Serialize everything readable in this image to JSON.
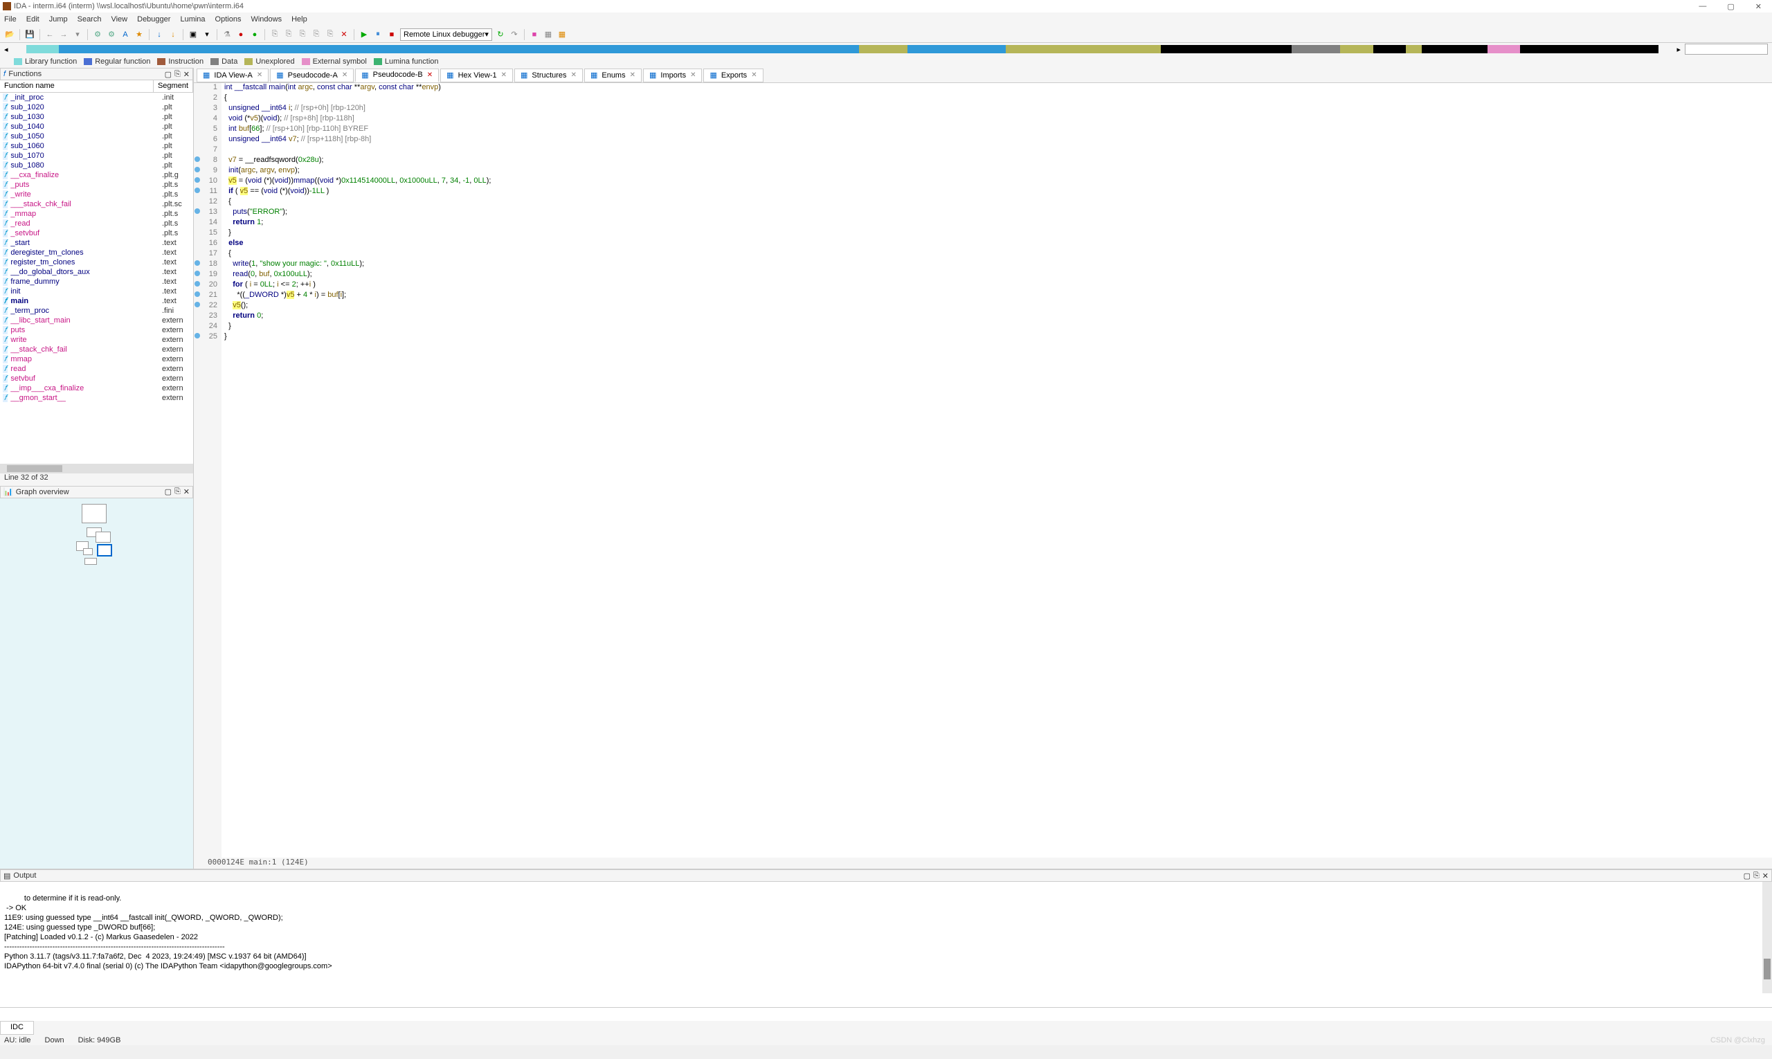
{
  "title": "IDA - interm.i64 (interm) \\\\wsl.localhost\\Ubuntu\\home\\pwn\\interm.i64",
  "menu": [
    "File",
    "Edit",
    "Jump",
    "Search",
    "View",
    "Debugger",
    "Lumina",
    "Options",
    "Windows",
    "Help"
  ],
  "debugger_text": "Remote Linux debugger",
  "legend": [
    {
      "label": "Library function",
      "color": "#7FDBDB"
    },
    {
      "label": "Regular function",
      "color": "#4A6FD4"
    },
    {
      "label": "Instruction",
      "color": "#A05B3C"
    },
    {
      "label": "Data",
      "color": "#808080"
    },
    {
      "label": "Unexplored",
      "color": "#B5B558"
    },
    {
      "label": "External symbol",
      "color": "#E68FC9"
    },
    {
      "label": "Lumina function",
      "color": "#3CB371"
    }
  ],
  "functions_panel": {
    "title": "Functions",
    "cols": [
      "Function name",
      "Segment"
    ],
    "status": "Line 32 of 32"
  },
  "functions": [
    {
      "name": "_init_proc",
      "seg": ".init",
      "ext": false
    },
    {
      "name": "sub_1020",
      "seg": ".plt",
      "ext": false
    },
    {
      "name": "sub_1030",
      "seg": ".plt",
      "ext": false
    },
    {
      "name": "sub_1040",
      "seg": ".plt",
      "ext": false
    },
    {
      "name": "sub_1050",
      "seg": ".plt",
      "ext": false
    },
    {
      "name": "sub_1060",
      "seg": ".plt",
      "ext": false
    },
    {
      "name": "sub_1070",
      "seg": ".plt",
      "ext": false
    },
    {
      "name": "sub_1080",
      "seg": ".plt",
      "ext": false
    },
    {
      "name": "__cxa_finalize",
      "seg": ".plt.g",
      "ext": true
    },
    {
      "name": "_puts",
      "seg": ".plt.s",
      "ext": true
    },
    {
      "name": "_write",
      "seg": ".plt.s",
      "ext": true
    },
    {
      "name": "___stack_chk_fail",
      "seg": ".plt.sc",
      "ext": true
    },
    {
      "name": "_mmap",
      "seg": ".plt.s",
      "ext": true
    },
    {
      "name": "_read",
      "seg": ".plt.s",
      "ext": true
    },
    {
      "name": "_setvbuf",
      "seg": ".plt.s",
      "ext": true
    },
    {
      "name": "_start",
      "seg": ".text",
      "ext": false
    },
    {
      "name": "deregister_tm_clones",
      "seg": ".text",
      "ext": false
    },
    {
      "name": "register_tm_clones",
      "seg": ".text",
      "ext": false
    },
    {
      "name": "__do_global_dtors_aux",
      "seg": ".text",
      "ext": false
    },
    {
      "name": "frame_dummy",
      "seg": ".text",
      "ext": false
    },
    {
      "name": "init",
      "seg": ".text",
      "ext": false
    },
    {
      "name": "main",
      "seg": ".text",
      "ext": false,
      "bold": true
    },
    {
      "name": "_term_proc",
      "seg": ".fini",
      "ext": false
    },
    {
      "name": "__libc_start_main",
      "seg": "extern",
      "ext": true
    },
    {
      "name": "puts",
      "seg": "extern",
      "ext": true
    },
    {
      "name": "write",
      "seg": "extern",
      "ext": true
    },
    {
      "name": "__stack_chk_fail",
      "seg": "extern",
      "ext": true
    },
    {
      "name": "mmap",
      "seg": "extern",
      "ext": true
    },
    {
      "name": "read",
      "seg": "extern",
      "ext": true
    },
    {
      "name": "setvbuf",
      "seg": "extern",
      "ext": true
    },
    {
      "name": "__imp___cxa_finalize",
      "seg": "extern",
      "ext": true
    },
    {
      "name": "__gmon_start__",
      "seg": "extern",
      "ext": true
    }
  ],
  "graph_panel": {
    "title": "Graph overview"
  },
  "tabs": [
    {
      "label": "IDA View-A",
      "icon": "view"
    },
    {
      "label": "Pseudocode-A",
      "icon": "code"
    },
    {
      "label": "Pseudocode-B",
      "icon": "code",
      "active": true,
      "red": true
    },
    {
      "label": "Hex View-1",
      "icon": "hex"
    },
    {
      "label": "Structures",
      "icon": "struct"
    },
    {
      "label": "Enums",
      "icon": "enum"
    },
    {
      "label": "Imports",
      "icon": "import"
    },
    {
      "label": "Exports",
      "icon": "export"
    }
  ],
  "code_status": "0000124E main:1 (124E)",
  "code_lines": [
    {
      "n": 1,
      "html": "<span class='ty'>int</span> <span class='ty'>__fastcall</span> <span class='fn'>main</span>(<span class='ty'>int</span> <span class='vr'>argc</span>, <span class='ty'>const char</span> **<span class='vr'>argv</span>, <span class='ty'>const char</span> **<span class='vr'>envp</span>)"
    },
    {
      "n": 2,
      "html": "{"
    },
    {
      "n": 3,
      "html": "  <span class='ty'>unsigned __int64</span> <span class='vr'>i</span>; <span class='cm'>// [rsp+0h] [rbp-120h]</span>"
    },
    {
      "n": 4,
      "html": "  <span class='ty'>void</span> (*<span class='vr'>v5</span>)(<span class='ty'>void</span>); <span class='cm'>// [rsp+8h] [rbp-118h]</span>"
    },
    {
      "n": 5,
      "html": "  <span class='ty'>int</span> <span class='vr'>buf</span>[<span class='num'>66</span>]; <span class='cm'>// [rsp+10h] [rbp-110h] BYREF</span>"
    },
    {
      "n": 6,
      "html": "  <span class='ty'>unsigned __int64</span> <span class='vr'>v7</span>; <span class='cm'>// [rsp+118h] [rbp-8h]</span>"
    },
    {
      "n": 7,
      "html": ""
    },
    {
      "n": 8,
      "bp": true,
      "html": "  <span class='vr'>v7</span> = __readfsqword(<span class='num'>0x28u</span>);"
    },
    {
      "n": 9,
      "bp": true,
      "html": "  <span class='fn'>init</span>(<span class='vr'>argc</span>, <span class='vr'>argv</span>, <span class='vr'>envp</span>);"
    },
    {
      "n": 10,
      "bp": true,
      "html": "  <span class='vr hl'>v5</span> = (<span class='ty'>void</span> (*)(<span class='ty'>void</span>))<span class='fn'>mmap</span>((<span class='ty'>void</span> *)<span class='num'>0x114514000LL</span>, <span class='num'>0x1000uLL</span>, <span class='num'>7</span>, <span class='num'>34</span>, <span class='num'>-1</span>, <span class='num'>0LL</span>);"
    },
    {
      "n": 11,
      "bp": true,
      "html": "  <span class='kw'>if</span> ( <span class='vr hl'>v5</span> == (<span class='ty'>void</span> (*)(<span class='ty'>void</span>))<span class='num'>-1LL</span> )"
    },
    {
      "n": 12,
      "html": "  {"
    },
    {
      "n": 13,
      "bp": true,
      "html": "    <span class='fn'>puts</span>(<span class='str'>\"ERROR\"</span>);"
    },
    {
      "n": 14,
      "html": "    <span class='kw'>return</span> <span class='num'>1</span>;"
    },
    {
      "n": 15,
      "html": "  }"
    },
    {
      "n": 16,
      "html": "  <span class='kw'>else</span>"
    },
    {
      "n": 17,
      "html": "  {"
    },
    {
      "n": 18,
      "bp": true,
      "html": "    <span class='fn'>write</span>(<span class='num'>1</span>, <span class='str'>\"show your magic: \"</span>, <span class='num'>0x11uLL</span>);"
    },
    {
      "n": 19,
      "bp": true,
      "html": "    <span class='fn'>read</span>(<span class='num'>0</span>, <span class='vr'>buf</span>, <span class='num'>0x100uLL</span>);"
    },
    {
      "n": 20,
      "bp": true,
      "html": "    <span class='kw'>for</span> ( <span class='vr'>i</span> = <span class='num'>0LL</span>; <span class='vr'>i</span> &lt;= <span class='num'>2</span>; ++<span class='vr'>i</span> )"
    },
    {
      "n": 21,
      "bp": true,
      "html": "      *((<span class='ty'>_DWORD</span> *)<span class='vr hl'>v5</span> + <span class='num'>4</span> * <span class='vr'>i</span>) = <span class='vr'>buf</span>[<span class='vr'>i</span>];"
    },
    {
      "n": 22,
      "bp": true,
      "html": "    <span class='vr hl'>v5</span>();"
    },
    {
      "n": 23,
      "html": "    <span class='kw'>return</span> <span class='num'>0</span>;"
    },
    {
      "n": 24,
      "html": "  }"
    },
    {
      "n": 25,
      "bp": true,
      "html": "}"
    }
  ],
  "output_panel": {
    "title": "Output"
  },
  "output_text": "to determine if it is read-only.\n -> OK\n11E9: using guessed type __int64 __fastcall init(_QWORD, _QWORD, _QWORD);\n124E: using guessed type _DWORD buf[66];\n[Patching] Loaded v0.1.2 - (c) Markus Gaasedelen - 2022\n---------------------------------------------------------------------------------------\nPython 3.11.7 (tags/v3.11.7:fa7a6f2, Dec  4 2023, 19:24:49) [MSC v.1937 64 bit (AMD64)]\nIDAPython 64-bit v7.4.0 final (serial 0) (c) The IDAPython Team <idapython@googlegroups.com>\n",
  "idc_tab": "IDC",
  "status": {
    "au": "AU:  idle",
    "down": "Down",
    "disk": "Disk: 949GB"
  },
  "watermark": "CSDN @Clxhzg"
}
